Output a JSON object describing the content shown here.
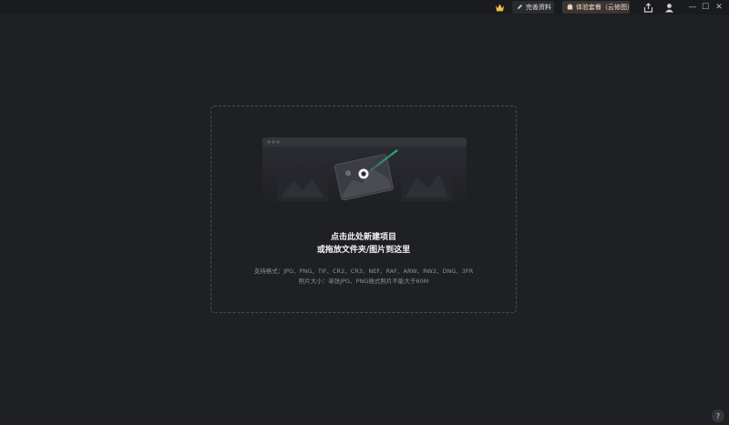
{
  "topbar": {
    "crown_icon": "crown-icon",
    "profile_label": "完善资料",
    "plan_label": "体验套餐（云修图）",
    "share_icon": "share-icon",
    "user_icon": "user-icon",
    "window": {
      "minimize": "—",
      "maximize": "☐",
      "close": "✕"
    }
  },
  "dropzone": {
    "title_line1": "点击此处新建项目",
    "title_line2": "或拖放文件夹/图片到这里",
    "formats": "支持格式：JPG、PNG、TIF、CR2、CR3、NEF、RAF、ARW、RW2、DNG、3FR",
    "size_limit": "照片大小：单张JPG、PNG格式照片不能大于60M"
  },
  "help": {
    "label": "?"
  },
  "colors": {
    "background": "#1f2024",
    "topbar": "#1a1b1e",
    "accent_green": "#2fbf8f",
    "plan_pill": "#3a3532"
  }
}
